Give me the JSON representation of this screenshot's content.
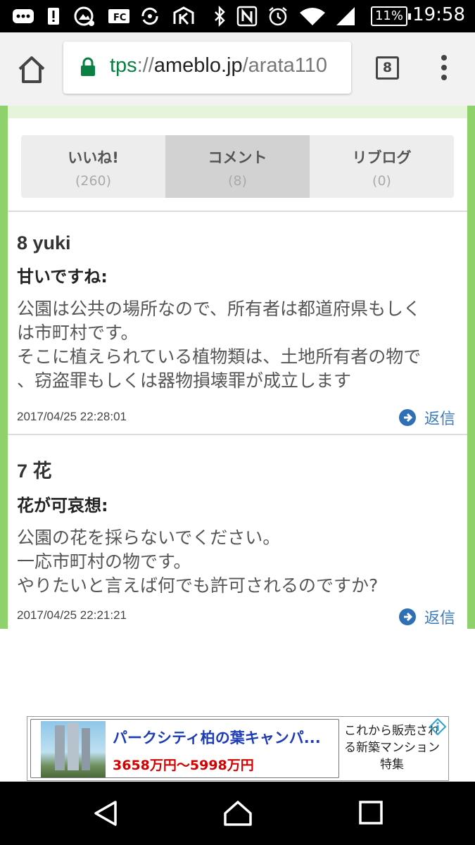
{
  "status_bar": {
    "time": "19:58",
    "battery": "11%",
    "icons": [
      "message-icon",
      "alert-icon",
      "camera-icon",
      "fc-icon",
      "sync-icon",
      "k-icon",
      "bluetooth-icon",
      "nfc-icon",
      "alarm-icon",
      "wifi-icon",
      "signal-icon"
    ]
  },
  "browser": {
    "url_scheme": "tps",
    "url_sep": "://",
    "url_host": "ameblo.jp",
    "url_path": "/arata110",
    "tab_count": "8"
  },
  "page": {
    "tabs": [
      {
        "label": "いいね!",
        "count": "(260)"
      },
      {
        "label": "コメント",
        "count": "(8)"
      },
      {
        "label": "リブログ",
        "count": "(0)"
      }
    ],
    "comments": [
      {
        "header": "8 yuki",
        "title": "甘いですね:",
        "body": "公園は公共の場所なので、所有者は都道府県もしく\nは市町村です。\nそこに植えられている植物類は、土地所有者の物で\n、窃盗罪もしくは器物損壊罪が成立します",
        "date": "2017/04/25 22:28:01",
        "reply": "返信"
      },
      {
        "header": "7 花",
        "title": "花が可哀想:",
        "body": "公園の花を採らないでください。\n一応市町村の物です。\nやりたいと言えば何でも許可されるのですか?",
        "date": "2017/04/25 22:21:21",
        "reply": "返信"
      }
    ]
  },
  "ad": {
    "title": "パークシティ柏の葉キャンパ...",
    "price": "3658万円〜5998万円",
    "side_text": "これから販売される新築マンション特集"
  },
  "colors": {
    "accent_green": "#8fd16a",
    "link_blue": "#3a7bc0",
    "secure_green": "#0b8043"
  }
}
